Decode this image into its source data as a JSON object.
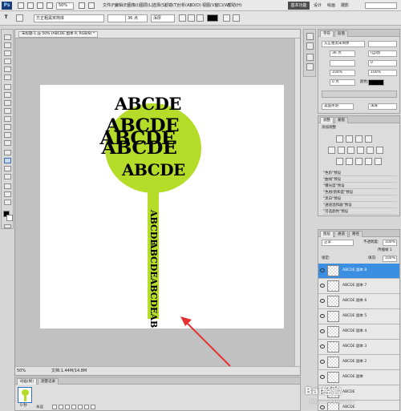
{
  "menubar": {
    "logo": "Ps",
    "zoom": "50%",
    "items": [
      "文件(F)",
      "编辑(E)",
      "图像(I)",
      "图层(L)",
      "选择(S)",
      "滤镜(T)",
      "分析(A)",
      "3D(D)",
      "视图(V)",
      "窗口(W)",
      "帮助(H)"
    ],
    "workspace_active": "基本功能",
    "workspace_items": [
      "设计",
      "绘画",
      "摄影"
    ]
  },
  "options": {
    "tool_glyph": "T",
    "font_family": "方正粗黑宋简体",
    "font_size": "36 点",
    "aa": "浑厚"
  },
  "document": {
    "tab_title": "未标题-1 @ 50% (ABCDE 副本 9, RGB/8) *",
    "status_zoom": "50%",
    "status_doc": "文档:1.44M/14.8M",
    "canvas_texts": [
      "ABCDE",
      "ABCDE",
      "ABCDE",
      "ABCDE",
      "ABCDE"
    ],
    "vertical_texts": [
      "ABCDEABCDEABCDE",
      "ABCDE"
    ]
  },
  "char_panel": {
    "tabs": [
      "字符",
      "段落"
    ],
    "font_family": "方正粗黑宋简体",
    "font_size": "36 点",
    "leading": "(自动)",
    "tracking": "0",
    "vscale": "100%",
    "hscale": "100%",
    "baseline": "0 点",
    "color_label": "颜色:",
    "language": "美国英语",
    "aa": "浑厚"
  },
  "adjust_panel": {
    "tabs": [
      "调整",
      "蒙版"
    ],
    "title": "添加调整",
    "presets": [
      "\"色阶\"预设",
      "\"曲线\"预设",
      "\"曝光度\"预设",
      "\"色相/饱和度\"预设",
      "\"黑白\"预设",
      "\"通道混和器\"预设",
      "\"可选颜色\"预设"
    ]
  },
  "layers_panel": {
    "tabs": [
      "图层",
      "通道",
      "路径"
    ],
    "blend_mode": "正常",
    "opacity_label": "不透明度:",
    "opacity": "100%",
    "lock_label": "锁定:",
    "fill_label": "填充:",
    "fill": "100%",
    "propagate_label": "传播帧 1",
    "layers": [
      "ABCDE 副本 8",
      "ABCDE 副本 7",
      "ABCDE 副本 6",
      "ABCDE 副本 5",
      "ABCDE 副本 4",
      "ABCDE 副本 3",
      "ABCDE 副本 2",
      "ABCDE 副本",
      "ABCDE",
      "ABCDE"
    ]
  },
  "anim_panel": {
    "tabs": [
      "动画(帧)",
      "测量记录"
    ],
    "frame_time": "0 秒",
    "loop": "永远"
  },
  "watermark": {
    "title": "Bai经验",
    "url": "jingyan.baidu.com"
  },
  "colors": {
    "accent": "#3a8fe3",
    "lime": "#b5dc28",
    "arrow": "#e53030"
  }
}
